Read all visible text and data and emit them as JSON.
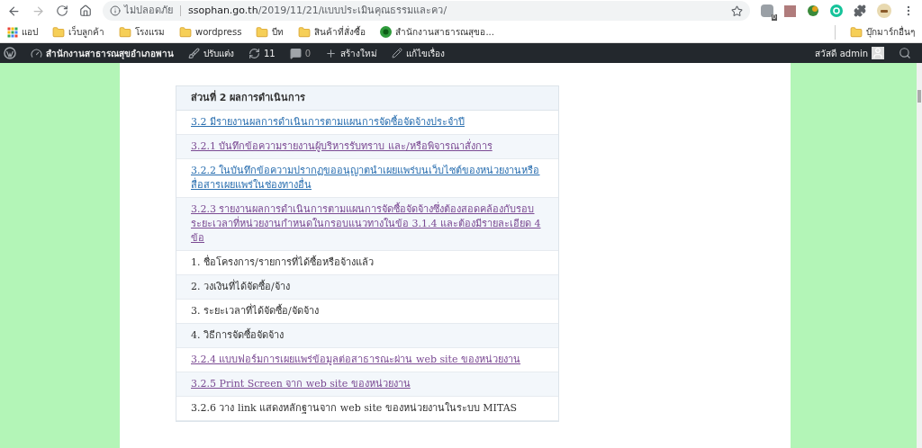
{
  "browser": {
    "security": "ไม่ปลอดภัย",
    "url_host": "ssophan.go.th",
    "url_path": "/2019/11/21/แบบประเมินคุณธรรมและคว/",
    "extension_badge": "0"
  },
  "bookmarks": [
    {
      "kind": "apps",
      "label": "แอป"
    },
    {
      "kind": "folder",
      "label": "เว็บลูกค้า"
    },
    {
      "kind": "folder",
      "label": "โรงแรม"
    },
    {
      "kind": "folder",
      "label": "wordpress"
    },
    {
      "kind": "folder",
      "label": "บีท"
    },
    {
      "kind": "folder",
      "label": "สินค้าที่สั่งซื้อ"
    },
    {
      "kind": "site",
      "label": "สำนักงานสาธารณสุขอ..."
    }
  ],
  "other_bookmarks": "บุ๊กมาร์กอื่นๆ",
  "admin_bar": {
    "site": "สำนักงานสาธารณสุขอำเภอพาน",
    "customize": "ปรับแต่ง",
    "updates": "11",
    "comments": "0",
    "new": "สร้างใหม่",
    "edit": "แก้ไขเรื่อง",
    "greeting": "สวัสดี admin"
  },
  "table": {
    "heading": "ส่วนที่ 2 ผลการดำเนินการ",
    "rows": [
      {
        "kind": "link",
        "text": "3.2 มีรายงานผลการดำเนินการตามแผนการจัดซื้อจัดจ้างประจำปี"
      },
      {
        "kind": "visited",
        "text": "3.2.1 บันทึกข้อความรายงานผู้บริหารรับทราบ และ/หรือพิจารณาสั่งการ"
      },
      {
        "kind": "link",
        "text": "3.2.2 ในบันทึกข้อความปรากฏขออนุญาตนำเผยแพร่บนเว็บไซต์ของหน่วยงานหรือสื่อสารเผยแพร่ในช่องทางอื่น"
      },
      {
        "kind": "visited",
        "text": "3.2.3 รายงานผลการดำเนินการตามแผนการจัดซื้อจัดจ้างซึ่งต้องสอดคล้องกับรอบระยะเวลาที่หน่วยงานกำหนดในกรอบแนวทางในข้อ 3.1.4 และต้องมีรายละเอียด 4 ข้อ"
      },
      {
        "kind": "text",
        "text": "1. ชื่อโครงการ/รายการที่ได้ซื้อหรือจ้างแล้ว"
      },
      {
        "kind": "text",
        "text": "2. วงเงินที่ได้จัดซื้อ/จ้าง"
      },
      {
        "kind": "text",
        "text": "3. ระยะเวลาที่ได้จัดซื้อ/จัดจ้าง"
      },
      {
        "kind": "text",
        "text": "4. วิธีการจัดซื้อจัดจ้าง"
      },
      {
        "kind": "visited",
        "text": "3.2.4 แบบฟอร์มการเผยแพร่ข้อมูลต่อสาธารณะผ่าน web site ของหน่วยงาน"
      },
      {
        "kind": "visited",
        "text": "3.2.5 Print Screen จาก web site ของหน่วยงาน"
      },
      {
        "kind": "text",
        "text": "3.2.6 วาง link แสดงหลักฐานจาก web site ของหน่วยงานในระบบ MITAS"
      }
    ]
  }
}
